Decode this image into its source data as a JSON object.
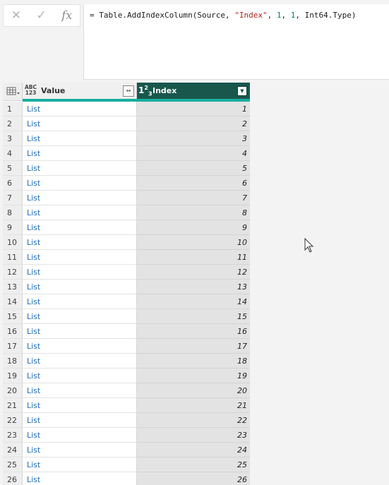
{
  "formula_bar": {
    "cancel_icon": "close-x-icon",
    "confirm_icon": "checkmark-icon",
    "fx_label": "fx",
    "formula_parts": [
      "= Table.AddIndexColumn(Source, ",
      "\"Index\"",
      ", ",
      "1",
      ", ",
      "1",
      ", Int64.Type)"
    ]
  },
  "grid": {
    "corner_icon": "table-menu-icon",
    "columns": [
      {
        "name": "Value",
        "type_label_top": "ABC",
        "type_label_bottom": "123",
        "action": "expand"
      },
      {
        "name": "Index",
        "type_label": "123",
        "selected": true,
        "action": "filter"
      }
    ],
    "rows": [
      {
        "num": "1",
        "value": "List",
        "index": "1"
      },
      {
        "num": "2",
        "value": "List",
        "index": "2"
      },
      {
        "num": "3",
        "value": "List",
        "index": "3"
      },
      {
        "num": "4",
        "value": "List",
        "index": "4"
      },
      {
        "num": "5",
        "value": "List",
        "index": "5"
      },
      {
        "num": "6",
        "value": "List",
        "index": "6"
      },
      {
        "num": "7",
        "value": "List",
        "index": "7"
      },
      {
        "num": "8",
        "value": "List",
        "index": "8"
      },
      {
        "num": "9",
        "value": "List",
        "index": "9"
      },
      {
        "num": "10",
        "value": "List",
        "index": "10"
      },
      {
        "num": "11",
        "value": "List",
        "index": "11"
      },
      {
        "num": "12",
        "value": "List",
        "index": "12"
      },
      {
        "num": "13",
        "value": "List",
        "index": "13"
      },
      {
        "num": "14",
        "value": "List",
        "index": "14"
      },
      {
        "num": "15",
        "value": "List",
        "index": "15"
      },
      {
        "num": "16",
        "value": "List",
        "index": "16"
      },
      {
        "num": "17",
        "value": "List",
        "index": "17"
      },
      {
        "num": "18",
        "value": "List",
        "index": "18"
      },
      {
        "num": "19",
        "value": "List",
        "index": "19"
      },
      {
        "num": "20",
        "value": "List",
        "index": "20"
      },
      {
        "num": "21",
        "value": "List",
        "index": "21"
      },
      {
        "num": "22",
        "value": "List",
        "index": "22"
      },
      {
        "num": "23",
        "value": "List",
        "index": "23"
      },
      {
        "num": "24",
        "value": "List",
        "index": "24"
      },
      {
        "num": "25",
        "value": "List",
        "index": "25"
      },
      {
        "num": "26",
        "value": "List",
        "index": "26"
      }
    ]
  },
  "colors": {
    "selected_header": "#19574c",
    "header_accent": "#1aaea0",
    "list_link": "#1f6dbd"
  }
}
